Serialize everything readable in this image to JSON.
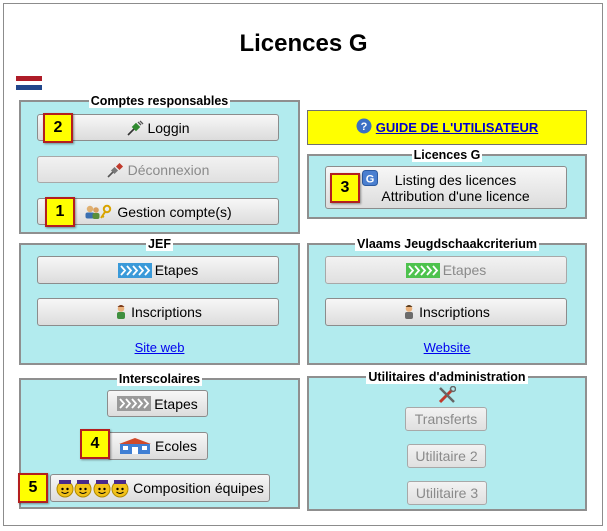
{
  "page": {
    "title": "Licences G",
    "flag_colors": [
      "#ae1c28",
      "#ffffff",
      "#21468b"
    ]
  },
  "comptes": {
    "legend": "Comptes responsables",
    "login_label": "Loggin",
    "logout_label": "Déconnexion",
    "account_label": "Gestion compte(s)"
  },
  "guide": {
    "label": "GUIDE DE L'UTILISATEUR",
    "background": "#ffff00"
  },
  "licences": {
    "legend": "Licences G",
    "listing_line1": "Listing des licences",
    "listing_line2": "Attribution d'une licence"
  },
  "jef": {
    "legend": "JEF",
    "etapes_label": "Etapes",
    "inscriptions_label": "Inscriptions",
    "link_label": "Site web"
  },
  "vjk": {
    "legend": "Vlaams Jeugdschaakcriterium",
    "etapes_label": "Etapes",
    "inscriptions_label": "Inscriptions",
    "link_label": "Website"
  },
  "interscolaires": {
    "legend": "Interscolaires",
    "etapes_label": "Etapes",
    "ecoles_label": "Ecoles",
    "composition_label": "Composition équipes"
  },
  "utilitaires": {
    "legend": "Utilitaires d'administration",
    "transferts_label": "Transferts",
    "util2_label": "Utilitaire 2",
    "util3_label": "Utilitaire 3"
  },
  "callouts": {
    "b1": "1",
    "b2": "2",
    "b3": "3",
    "b4": "4",
    "b5": "5"
  },
  "colors": {
    "panel_bg": "#b2ebee",
    "link": "#0000ee",
    "badge_bg": "#ffff00",
    "badge_border": "#b41e1e"
  },
  "icons": {
    "login": "plug-icon",
    "logout": "unplug-icon",
    "account": "users-key-icon",
    "guide": "help-icon",
    "licences": "g-icon",
    "etapes": "arrows-icon",
    "inscriptions": "child-icon",
    "ecoles": "school-icon",
    "composition": "team-faces-icon",
    "utilitaires": "tools-icon"
  }
}
